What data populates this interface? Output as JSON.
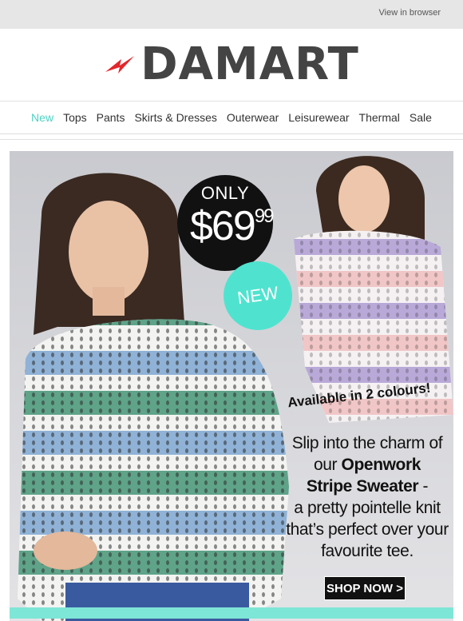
{
  "header": {
    "view_in_browser": "View in browser",
    "brand": "DAMART"
  },
  "nav": {
    "items": [
      {
        "label": "New",
        "active": true
      },
      {
        "label": "Tops"
      },
      {
        "label": "Pants"
      },
      {
        "label": "Skirts & Dresses"
      },
      {
        "label": "Outerwear"
      },
      {
        "label": "Leisurewear"
      },
      {
        "label": "Thermal"
      },
      {
        "label": "Sale"
      }
    ]
  },
  "hero": {
    "price_badge": {
      "prefix": "ONLY",
      "price": "$69",
      "cents": "99"
    },
    "new_badge": "NEW",
    "availability": "Available in 2 colours!",
    "copy": {
      "line1": "Slip into the charm of",
      "line2_pre": "our ",
      "line2_bold": "Openwork",
      "line3_bold": "Stripe Sweater",
      "line3_post": " -",
      "line4": "a pretty pointelle knit",
      "line5": "that’s perfect over your",
      "line6": "favourite tee."
    },
    "cta": "SHOP NOW >"
  },
  "colors": {
    "accent": "#4ed2c3",
    "badge_teal": "#4fe3cf",
    "brand_red": "#e3262b",
    "logo_grey": "#444444",
    "stripe_green": "#5fa389",
    "stripe_blue": "#8fb2d6",
    "stripe_lilac": "#b9a9d8",
    "stripe_pink": "#f1c6c6"
  }
}
